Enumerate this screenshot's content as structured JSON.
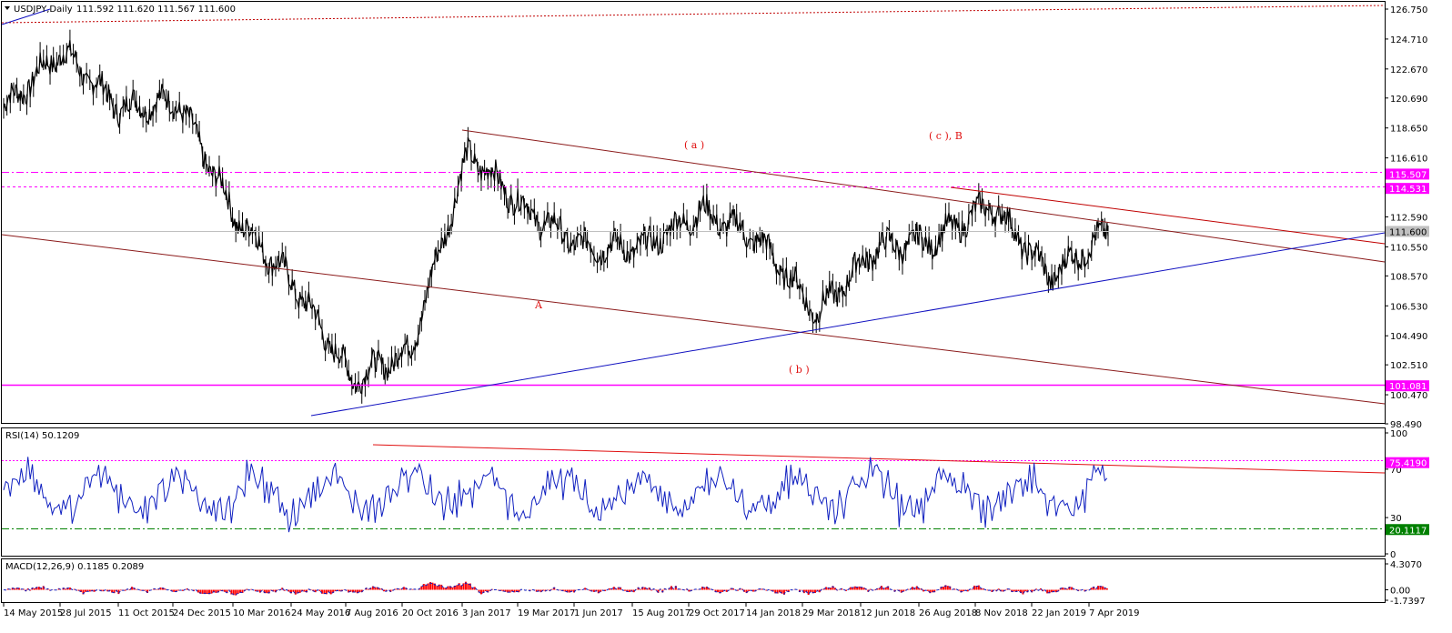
{
  "main_header": {
    "symbol": "USDJPY,Daily",
    "ohlc": "111.592 111.620 111.567 111.600"
  },
  "price_axis": {
    "ticks": [
      "126.750",
      "124.710",
      "122.670",
      "120.690",
      "118.650",
      "116.610",
      "114.531",
      "112.590",
      "110.550",
      "108.570",
      "106.530",
      "104.490",
      "102.510",
      "100.470",
      "98.490"
    ]
  },
  "price_badges": [
    {
      "label": "115.507",
      "value": 115.507,
      "color": "#ff00ff"
    },
    {
      "label": "114.531",
      "value": 114.531,
      "color": "#ff00ff"
    },
    {
      "label": "111.600",
      "value": 111.6,
      "color": "#c0c0c0"
    },
    {
      "label": "101.081",
      "value": 101.081,
      "color": "#ff00ff"
    }
  ],
  "wave_labels": {
    "a": "( a )",
    "cB": "( c ), B",
    "A": "A",
    "b": "( b )"
  },
  "rsi_panel": {
    "header": "RSI(14) 50.1209",
    "ticks": [
      "100",
      "70",
      "30",
      "0"
    ],
    "level_high_label": "75.4190",
    "level_high": 75.419,
    "level_low_label": "20.1117",
    "level_low": 20.1117
  },
  "macd_panel": {
    "header": "MACD(12,26,9) 0.1185 0.2089",
    "ticks": [
      "4.3070",
      "0.00",
      "-1.7397"
    ]
  },
  "time_axis": {
    "labels": [
      "14 May 2015",
      "28 Jul 2015",
      "11 Oct 2015",
      "24 Dec 2015",
      "10 Mar 2016",
      "24 May 2016",
      "7 Aug 2016",
      "20 Oct 2016",
      "3 Jan 2017",
      "19 Mar 2017",
      "1 Jun 2017",
      "15 Aug 2017",
      "29 Oct 2017",
      "14 Jan 2018",
      "29 Mar 2018",
      "12 Jun 2018",
      "26 Aug 2018",
      "8 Nov 2018",
      "22 Jan 2019",
      "7 Apr 2019"
    ]
  },
  "chart_data": {
    "type": "line",
    "symbol": "USDJPY",
    "timeframe": "Daily",
    "x": [
      "14 May 2015",
      "28 Jul 2015",
      "11 Oct 2015",
      "24 Dec 2015",
      "10 Mar 2016",
      "24 May 2016",
      "7 Aug 2016",
      "20 Oct 2016",
      "3 Jan 2017",
      "19 Mar 2017",
      "1 Jun 2017",
      "15 Aug 2017",
      "29 Oct 2017",
      "14 Jan 2018",
      "29 Mar 2018",
      "12 Jun 2018",
      "26 Aug 2018",
      "8 Nov 2018",
      "22 Jan 2019",
      "7 Apr 2019"
    ],
    "series": [
      {
        "values": [
          120.0,
          123.9,
          120.0,
          120.5,
          112.5,
          108.0,
          101.5,
          103.5,
          117.0,
          113.0,
          110.5,
          110.5,
          113.0,
          111.0,
          106.0,
          110.5,
          111.0,
          113.5,
          108.5,
          111.6
        ]
      }
    ],
    "ylim": [
      98.49,
      126.75
    ],
    "rsi": {
      "last": 50.1209,
      "levels": [
        75.419,
        20.1117
      ],
      "ylim": [
        0,
        100
      ]
    },
    "macd": {
      "main": 0.1185,
      "signal": 0.2089,
      "ylim": [
        -1.7397,
        4.307
      ]
    },
    "colors": {
      "trend_red": "#8b1a1a",
      "trend_blue": "#1010c0",
      "levels": "#ff00ff",
      "rsi_line": "#1020c0",
      "macd_hist": "#ff0000"
    }
  }
}
